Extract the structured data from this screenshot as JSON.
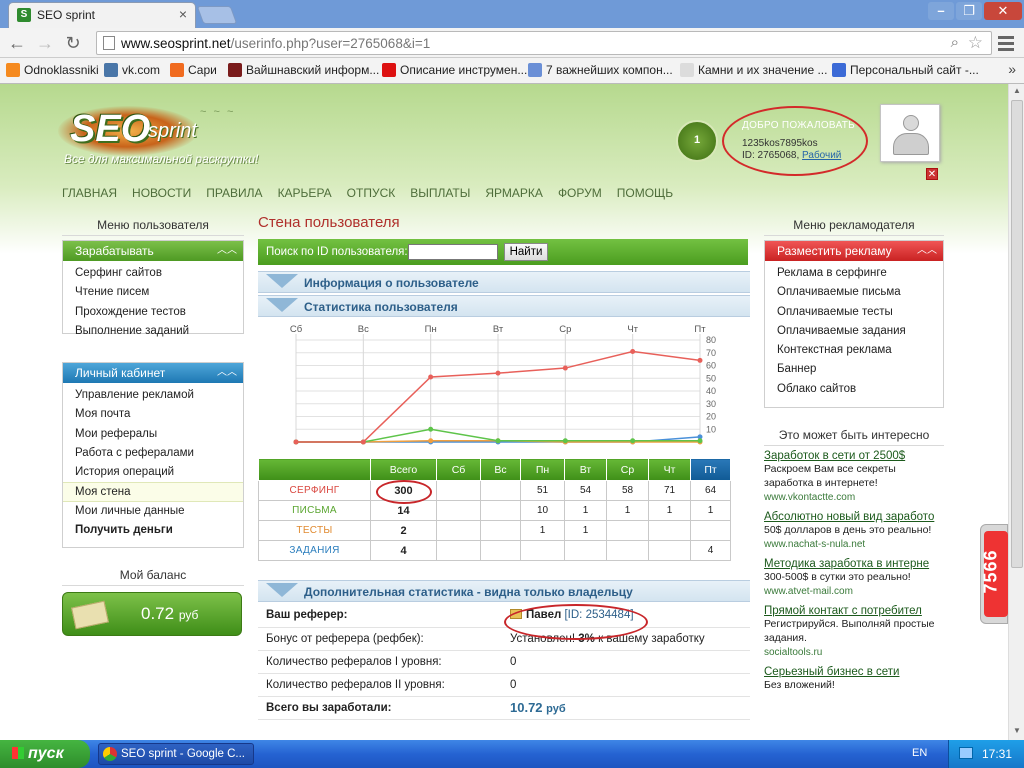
{
  "browser": {
    "tab_title": "SEO sprint",
    "tab_favicon": "S",
    "url_host": "www.seosprint.net",
    "url_path": "/userinfo.php?user=2765068&i=1",
    "bookmarks": [
      {
        "label": "Odnoklassniki",
        "icon": "odnoklassniki-icon",
        "color": "#f58a1f"
      },
      {
        "label": "vk.com",
        "icon": "vk-icon",
        "color": "#4a76a8"
      },
      {
        "label": "Сари",
        "icon": "sari-icon",
        "color": "#f06b1f"
      },
      {
        "label": "Вайшнавский информ...",
        "icon": "vaishnava-icon",
        "color": "#7a1c1c"
      },
      {
        "label": "Описание инструмен...",
        "icon": "p-icon",
        "color": "#d11"
      },
      {
        "label": "7 важнейших компон...",
        "icon": "components-icon",
        "color": "#6a8fd6"
      },
      {
        "label": "Камни и их значение ...",
        "icon": "page-icon",
        "color": "#dcdcdc"
      },
      {
        "label": "Персональный сайт -...",
        "icon": "personal-site-icon",
        "color": "#3b6ad6"
      }
    ]
  },
  "site": {
    "logo_main": "SEO",
    "logo_sub": "sprint",
    "tagline": "Все для максимальной раскрутки!",
    "medal_level": "1",
    "welcome": {
      "heading": "ДОБРО ПОЖАЛОВАТЬ",
      "login": "1235kos7895kos",
      "id_prefix": "ID: 2765068,",
      "status": "Рабочий"
    },
    "nav": [
      "ГЛАВНАЯ",
      "НОВОСТИ",
      "ПРАВИЛА",
      "КАРЬЕРА",
      "ОТПУСК",
      "ВЫПЛАТЫ",
      "ЯРМАРКА",
      "ФОРУМ",
      "ПОМОЩЬ"
    ]
  },
  "left": {
    "heading": "Меню пользователя",
    "earn": {
      "title": "Зарабатывать",
      "items": [
        "Серфинг сайтов",
        "Чтение писем",
        "Прохождение тестов",
        "Выполнение заданий"
      ]
    },
    "cabinet": {
      "title": "Личный кабинет",
      "items": [
        "Управление рекламой",
        "Моя почта",
        "Мои рефералы",
        "Работа с рефералами",
        "История операций",
        "Моя стена",
        "Мои личные данные",
        "Получить деньги"
      ],
      "active_index": 5,
      "bold_index": 7
    },
    "balance_heading": "Мой баланс",
    "balance_amount": "0.72",
    "balance_currency": "руб"
  },
  "center": {
    "page_title": "Стена пользователя",
    "search_label": "Поиск по ID пользователя:",
    "search_value": "",
    "search_button": "Найти",
    "section_info": "Информация о пользователе",
    "section_stats": "Статистика пользователя",
    "section_extra": "Дополнительная статистика - видна только владельцу",
    "extra_rows": [
      {
        "label": "Ваш реферер:",
        "value_name": "Павел",
        "value_id": "[ID: 2534484]"
      },
      {
        "label": "Бонус от реферера (рефбек):",
        "value_pre": "Установлен!",
        "value_bold": "3%",
        "value_post": "к вашему заработку"
      },
      {
        "label": "Количество рефералов I уровня:",
        "value": "0"
      },
      {
        "label": "Количество рефералов II уровня:",
        "value": "0"
      },
      {
        "label": "Всего вы заработали:",
        "value_amount": "10.72",
        "value_currency": "руб"
      }
    ]
  },
  "chart_data": {
    "type": "line",
    "categories": [
      "Сб",
      "Вс",
      "Пн",
      "Вт",
      "Ср",
      "Чт",
      "Пт"
    ],
    "series": [
      {
        "key": "serf",
        "values": [
          0,
          0,
          51,
          54,
          58,
          71,
          64
        ],
        "color": "#e8605a"
      },
      {
        "key": "mail",
        "values": [
          0,
          0,
          10,
          1,
          1,
          1,
          1
        ],
        "color": "#5ec44a"
      },
      {
        "key": "tests",
        "values": [
          0,
          0,
          1,
          1,
          0,
          0,
          0
        ],
        "color": "#f0a040"
      },
      {
        "key": "tasks",
        "values": [
          0,
          0,
          0,
          0,
          0,
          0,
          4
        ],
        "color": "#4a90d9"
      }
    ],
    "ylim": [
      0,
      80
    ],
    "yticks": [
      10,
      20,
      30,
      40,
      50,
      60,
      70,
      80
    ],
    "grid": true
  },
  "stats_table": {
    "headers": [
      "",
      "Всего",
      "Сб",
      "Вс",
      "Пн",
      "Вт",
      "Ср",
      "Чт",
      "Пт"
    ],
    "rows": [
      {
        "label": "СЕРФИНГ",
        "total": "300",
        "cells": [
          "",
          "",
          "51",
          "54",
          "58",
          "71",
          "64"
        ]
      },
      {
        "label": "ПИСЬМА",
        "total": "14",
        "cells": [
          "",
          "",
          "10",
          "1",
          "1",
          "1",
          "1"
        ]
      },
      {
        "label": "ТЕСТЫ",
        "total": "2",
        "cells": [
          "",
          "",
          "1",
          "1",
          "",
          "",
          ""
        ]
      },
      {
        "label": "ЗАДАНИЯ",
        "total": "4",
        "cells": [
          "",
          "",
          "",
          "",
          "",
          "",
          "4"
        ]
      }
    ]
  },
  "right": {
    "heading": "Меню рекламодателя",
    "menu_title": "Разместить рекламу",
    "items": [
      "Реклама в серфинге",
      "Оплачиваемые письма",
      "Оплачиваемые тесты",
      "Оплачиваемые задания",
      "Контекстная реклама",
      "Баннер",
      "Облако сайтов"
    ],
    "promo_heading": "Это может быть интересно",
    "ads": [
      {
        "title": "Заработок в сети от 2500$",
        "desc": "Раскроем Вам все секреты заработка в интернете!",
        "url": "www.vkontactte.com"
      },
      {
        "title": "Абсолютно новый вид заработо",
        "desc": "50$ долларов в день это реально!",
        "url": "www.nachat-s-nula.net"
      },
      {
        "title": "Методика заработка в интерне",
        "desc": "300-500$ в сутки это реально!",
        "url": "www.atvet-mail.com"
      },
      {
        "title": "Прямой контакт с потребител",
        "desc": "Регистрируйся. Выполняй простые задания.",
        "url": "socialtools.ru"
      },
      {
        "title": "Серьезный бизнес в сети",
        "desc": "Без вложений!",
        "url": ""
      }
    ],
    "widget_number": "7566"
  },
  "taskbar": {
    "start_label": "пуск",
    "task_label": "SEO sprint - Google C...",
    "lang": "EN",
    "time": "17:31"
  }
}
